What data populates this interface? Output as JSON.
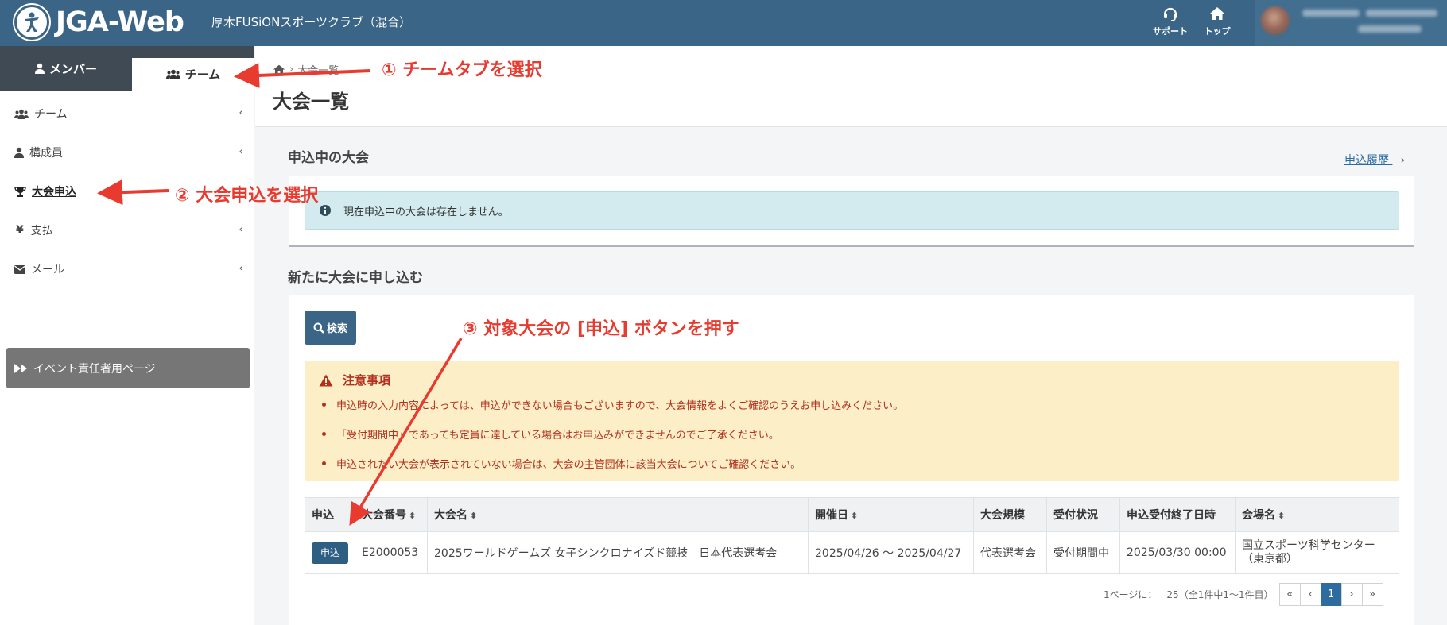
{
  "header": {
    "logo_text": "JGA-Web",
    "club_name": "厚木FUSiONスポーツクラブ（混合）",
    "support_label": "サポート",
    "top_label": "トップ"
  },
  "sidebar": {
    "tabs": [
      {
        "label": "メンバー"
      },
      {
        "label": "チーム"
      }
    ],
    "items": [
      {
        "label": "チーム"
      },
      {
        "label": "構成員"
      },
      {
        "label": "大会申込"
      },
      {
        "label": "支払"
      },
      {
        "label": "メール"
      }
    ],
    "event_button": "イベント責任者用ページ"
  },
  "breadcrumb": {
    "current": "大会一覧"
  },
  "page_title": "大会一覧",
  "applying": {
    "title": "申込中の大会",
    "history_link": "申込履歴",
    "info": "現在申込中の大会は存在しません。"
  },
  "new_apply": {
    "title": "新たに大会に申し込む",
    "search_label": "検索"
  },
  "notice": {
    "title": "注意事項",
    "items": [
      "申込時の入力内容によっては、申込ができない場合もございますので、大会情報をよくご確認のうえお申し込みください。",
      "「受付期間中」であっても定員に達している場合はお申込みができませんのでご了承ください。",
      "申込されたい大会が表示されていない場合は、大会の主管団体に該当大会についてご確認ください。"
    ]
  },
  "table": {
    "headers": [
      "申込",
      "大会番号",
      "大会名",
      "開催日",
      "大会規模",
      "受付状況",
      "申込受付終了日時",
      "会場名"
    ],
    "rows": [
      {
        "apply_label": "申込",
        "number": "E2000053",
        "name": "2025ワールドゲームズ 女子シンクロナイズド競技　日本代表選考会",
        "dates": "2025/04/26 〜 2025/04/27",
        "scale": "代表選考会",
        "status": "受付期間中",
        "deadline": "2025/03/30 00:00",
        "venue_line1": "国立スポーツ科学センター",
        "venue_line2": "（東京都）"
      }
    ]
  },
  "pagination": {
    "per_page_label": "1ページに：",
    "per_page": "25",
    "summary": "（全1件中1〜1件目）",
    "first": "«",
    "prev": "‹",
    "current": "1",
    "next": "›",
    "last": "»"
  },
  "annotations": {
    "step1": "① チームタブを選択",
    "step2": "② 大会申込を選択",
    "step3": "③ 対象大会の [申込] ボタンを押す"
  },
  "colors": {
    "header_bg": "#3a6587",
    "annotation_red": "#e83a2f",
    "notice_bg": "#fcefc7",
    "info_bg": "#d3ebef"
  }
}
